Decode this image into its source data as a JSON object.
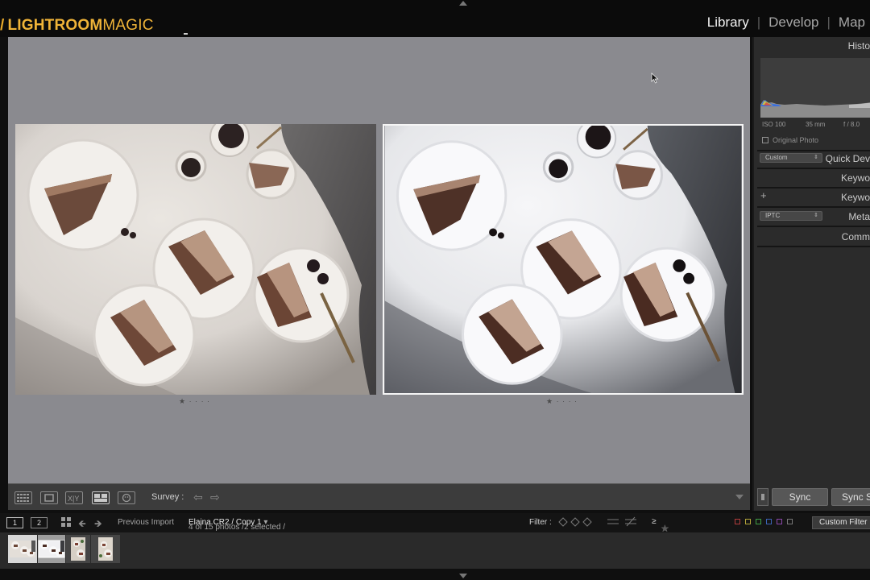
{
  "app": {
    "brand_primary": "LIGHTROOM",
    "brand_secondary": "MAGIC",
    "brand_color": "#f0b438"
  },
  "modules": [
    {
      "label": "Library",
      "active": true
    },
    {
      "label": "Develop",
      "active": false
    },
    {
      "label": "Map",
      "active": false
    }
  ],
  "toolbar": {
    "survey_label": "Survey :"
  },
  "photos": [
    {
      "name": "Elaina.CR2",
      "view": "before",
      "rating_dots": "★ · · · ·"
    },
    {
      "name": "Elaina.CR2 / Copy 1",
      "view": "after",
      "rating_dots": "★ · · · ·"
    }
  ],
  "right_panel": {
    "histogram_title": "Histo",
    "iso": "ISO 100",
    "focal": "35 mm",
    "aperture": "f / 8.0",
    "original_photo": "Original Photo",
    "quick_develop_select": "Custom",
    "quick_develop_title": "Quick Dev",
    "keywording_title": "Keywo",
    "keyword_list_title": "Keywo",
    "metadata_select": "IPTC",
    "metadata_title": "Meta",
    "comments_title": "Comm",
    "sync_label": "Sync",
    "sync_settings_label": "Sync S"
  },
  "filmstrip_header": {
    "screen1": "1",
    "screen2": "2",
    "source": "Previous Import",
    "count_text": "4 of 15 photos /2 selected /",
    "filename": "Elaina.CR2 / Copy 1",
    "filter_label": "Filter :",
    "rating_op": "≥",
    "stars_filled": 1,
    "stars_total": 5,
    "custom_filter": "Custom Filter"
  },
  "filmstrip": {
    "thumbnails": [
      {
        "state": "selected-primary"
      },
      {
        "state": "selected"
      },
      {
        "state": "normal"
      },
      {
        "state": "normal"
      }
    ]
  }
}
